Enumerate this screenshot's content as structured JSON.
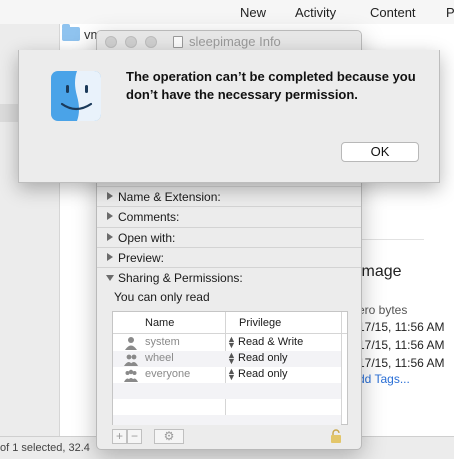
{
  "menubar": {
    "items": [
      "New",
      "Activity",
      "Content",
      "P"
    ]
  },
  "finder": {
    "folder_name": "vm",
    "file_name": "image",
    "size": "ero bytes",
    "dates": [
      "17/15, 11:56 AM",
      "17/15, 11:56 AM",
      "17/15, 11:56 AM"
    ],
    "add_tags": "dd Tags...",
    "status": "of 1 selected, 32.4"
  },
  "info_window": {
    "title": "sleepimage Info",
    "sections": {
      "name_extension": "Name & Extension:",
      "comments": "Comments:",
      "open_with": "Open with:",
      "preview": "Preview:",
      "sharing": "Sharing & Permissions:"
    },
    "permission_note": "You can only read",
    "table": {
      "headers": {
        "name": "Name",
        "privilege": "Privilege"
      },
      "rows": [
        {
          "name": "system",
          "privilege": "Read & Write",
          "icon": "single-user-icon"
        },
        {
          "name": "wheel",
          "privilege": "Read only",
          "icon": "group-icon"
        },
        {
          "name": "everyone",
          "privilege": "Read only",
          "icon": "everyone-icon"
        }
      ]
    },
    "tools": {
      "add": "+",
      "remove": "−",
      "action": "⚙"
    }
  },
  "alert": {
    "message": "The operation can’t be completed because you don’t have the necessary permission.",
    "ok_label": "OK"
  }
}
